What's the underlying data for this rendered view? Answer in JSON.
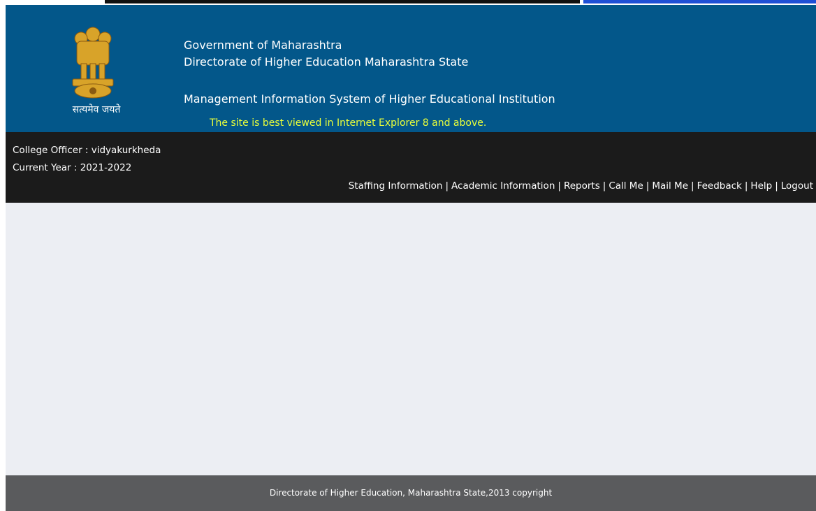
{
  "header": {
    "motto": "सत्यमेव जयते",
    "government": "Government of Maharashtra",
    "directorate": "Directorate of Higher Education Maharashtra State",
    "system": "Management Information System of Higher Educational Institution",
    "browser_note": "The site is best viewed in Internet Explorer 8 and above."
  },
  "user": {
    "officer": "College Officer : vidyakurkheda",
    "year": "Current Year : 2021-2022"
  },
  "nav": {
    "items": [
      "Staffing Information",
      "Academic Information",
      "Reports",
      "Call Me",
      "Mail Me",
      "Feedback",
      "Help",
      "Logout"
    ],
    "separator": "|"
  },
  "footer": {
    "copyright": "Directorate of Higher Education, Maharashtra State,2013 copyright"
  },
  "colors": {
    "header_bg": "#03578a",
    "infobar_bg": "#1b1b1b",
    "content_bg": "#eceef3",
    "footer_bg": "#5a5b5d",
    "note_yellow": "#eaff3a"
  }
}
